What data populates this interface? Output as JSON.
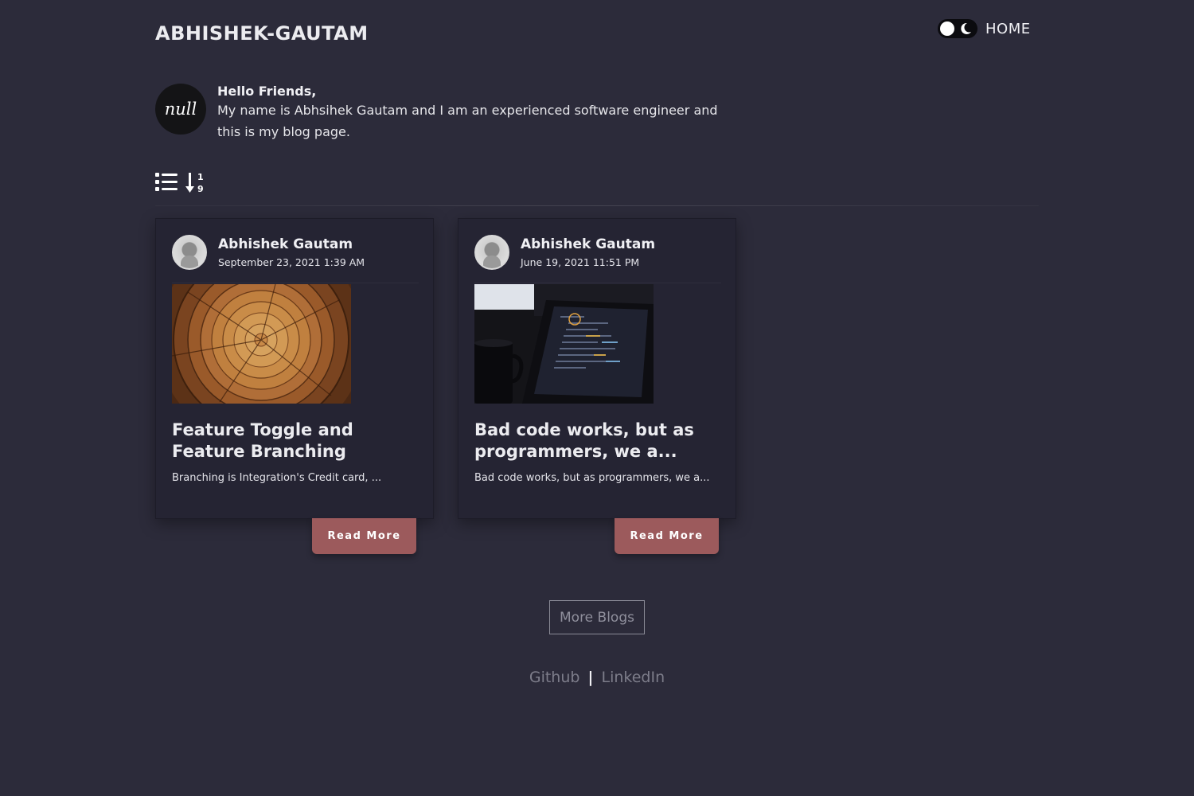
{
  "site": {
    "title": "ABHISHEK-GAUTAM",
    "nav_home": "HOME"
  },
  "intro": {
    "avatar_text": "null",
    "greeting": "Hello Friends,",
    "body": "My name is Abhsihek Gautam and I am an experienced software engineer and this is my blog page."
  },
  "tools": {
    "list_view_icon": "list-icon",
    "sort_icon": "sort-numeric-down-icon"
  },
  "posts": [
    {
      "author": "Abhishek Gautam",
      "date": "September 23, 2021 1:39 AM",
      "title": "Feature Toggle and Feature Branching",
      "excerpt": "Branching is Integration's Credit card, ...",
      "read_more": "Read More",
      "image": "tree-rings-photo"
    },
    {
      "author": "Abhishek Gautam",
      "date": "June 19, 2021 11:51 PM",
      "title": "Bad code works, but as programmers, we a...",
      "excerpt": "Bad code works, but as programmers, we a...",
      "read_more": "Read More",
      "image": "laptop-code-photo"
    }
  ],
  "more_blogs": "More Blogs",
  "footer": {
    "github": "Github",
    "separator": "|",
    "linkedin": "LinkedIn"
  },
  "colors": {
    "background": "#2c2b3a",
    "card": "#252433",
    "accent": "#9c5a5c"
  }
}
